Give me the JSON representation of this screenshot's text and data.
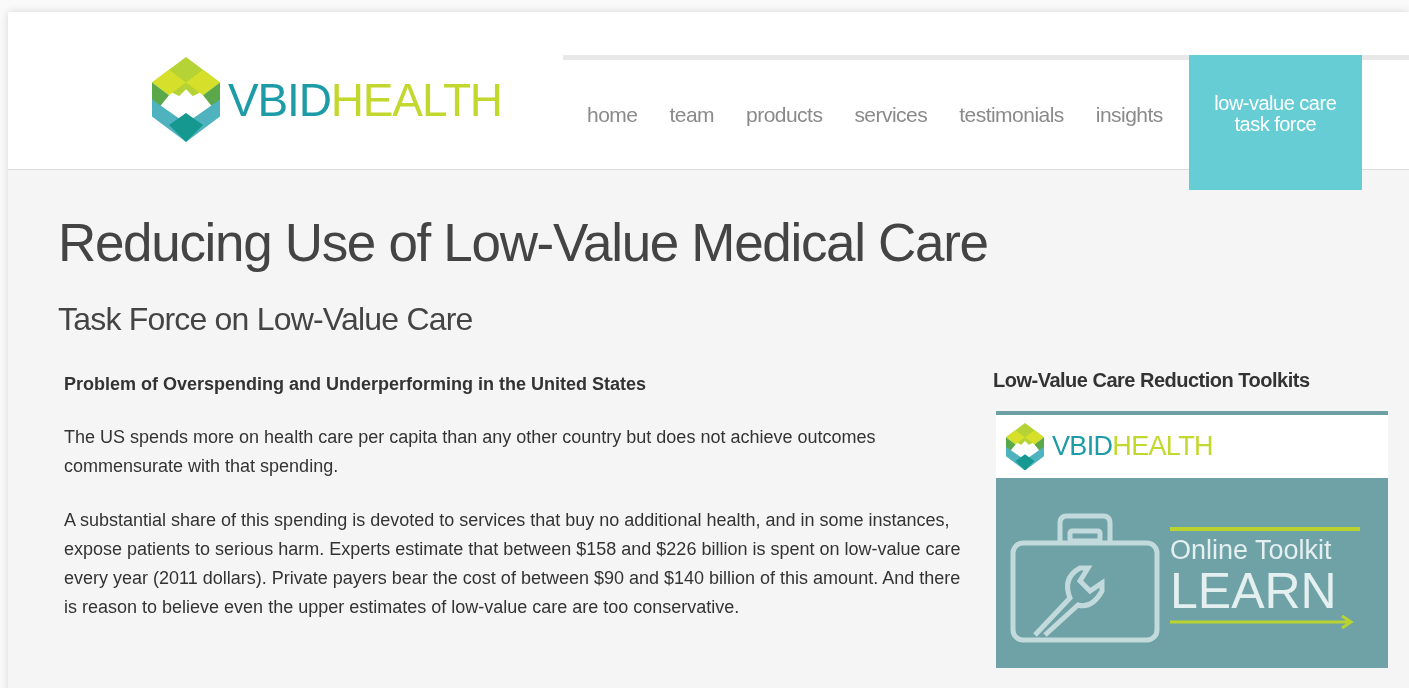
{
  "logo": {
    "first": "VBID",
    "second": "HEALTH"
  },
  "nav": [
    {
      "label": "home",
      "selected": false
    },
    {
      "label": "team",
      "selected": false
    },
    {
      "label": "products",
      "selected": false
    },
    {
      "label": "services",
      "selected": false
    },
    {
      "label": "testimonials",
      "selected": false
    },
    {
      "label": "insights",
      "selected": false
    },
    {
      "label": "low-value care task force",
      "selected": true
    }
  ],
  "title": "Reducing Use of Low-Value Medical Care",
  "subtitle": "Task Force on Low-Value Care",
  "article": {
    "heading": "Problem of Overspending and Underperforming in the United States",
    "paragraphs": [
      "The US spends more on health care per capita than any other country but does not achieve outcomes commensurate with that spending.",
      "A substantial share of this spending is devoted to services that buy no additional health, and in some instances, expose patients to serious harm. Experts estimate that between $158 and $226 billion is spent on low-value care every year (2011 dollars). Private payers bear the cost of between $90 and $140 billion of this amount. And there is reason to believe even the upper estimates of low-value care are too conservative."
    ]
  },
  "sidebar": {
    "heading": "Low-Value Care Reduction Toolkits",
    "card": {
      "logo": {
        "first": "VBID",
        "second": "HEALTH"
      },
      "line1": "Online Toolkit",
      "line2": "LEARN"
    }
  }
}
